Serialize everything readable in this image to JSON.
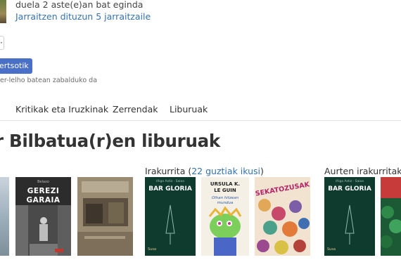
{
  "profile": {
    "ago_text": "duela 2 aste(e)an bat eginda",
    "followers_text": "Jarraitzen dituzun 5 jarraitzaile",
    "more_button": "·",
    "share_button": "pertsotik",
    "share_note": "er-lelho batean zabalduko da"
  },
  "tabs": [
    "Kritikak eta Iruzkinak",
    "Zerrendak",
    "Liburuak"
  ],
  "section_title": "r Bilbatua(r)en liburuak",
  "shelves": {
    "reading": {
      "label": "Irakurrita",
      "count_prefix": "(",
      "count_link": "22 guztiak ikusi",
      "count_suffix": ")"
    },
    "this_year": {
      "label": "Aurten irakurritako l"
    }
  },
  "covers": {
    "gerezi": {
      "publisher": "Belaxo",
      "title_line1": "GEREZI",
      "title_line2": "GARAIA"
    },
    "bar1": {
      "publisher": "Iñigo Astiz · Saioa",
      "title": "BAR GLORIA",
      "imprint": "Susa"
    },
    "leguin": {
      "author_line1": "URSULA K.",
      "author_line2": "LE GUIN",
      "title_line1": "Oihan hitzean",
      "title_line2": "mundua"
    },
    "sekatuak": {
      "title": "SEKATOZUSAK"
    },
    "bar2": {
      "publisher": "Iñigo Astiz · Saioa",
      "title": "BAR GLORIA",
      "imprint": "Susa"
    }
  }
}
